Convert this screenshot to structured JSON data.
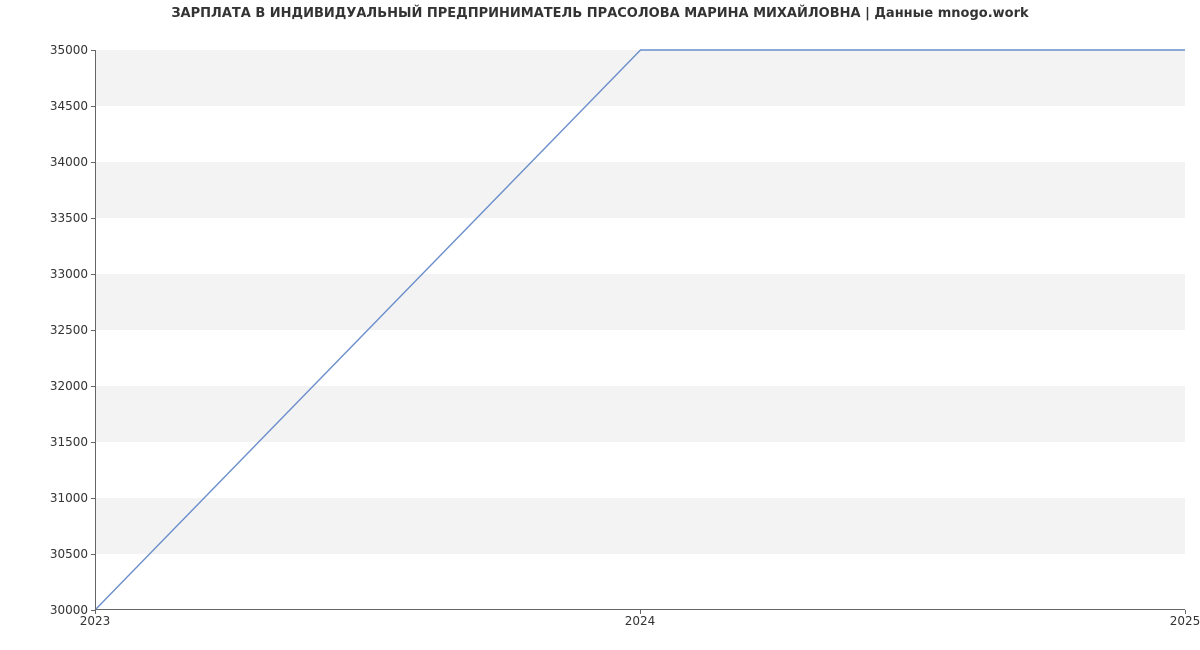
{
  "chart_data": {
    "type": "line",
    "title": "ЗАРПЛАТА В ИНДИВИДУАЛЬНЫЙ ПРЕДПРИНИМАТЕЛЬ ПРАСОЛОВА МАРИНА МИХАЙЛОВНА | Данные mnogo.work",
    "xlabel": "",
    "ylabel": "",
    "x": [
      2023,
      2024,
      2025
    ],
    "y": [
      30000,
      35000,
      35000
    ],
    "x_ticks": [
      2023,
      2024,
      2025
    ],
    "y_ticks": [
      30000,
      30500,
      31000,
      31500,
      32000,
      32500,
      33000,
      33500,
      34000,
      34500,
      35000
    ],
    "xlim": [
      2023,
      2025
    ],
    "ylim": [
      30000,
      35000
    ],
    "line_color": "#6a8ecb"
  }
}
